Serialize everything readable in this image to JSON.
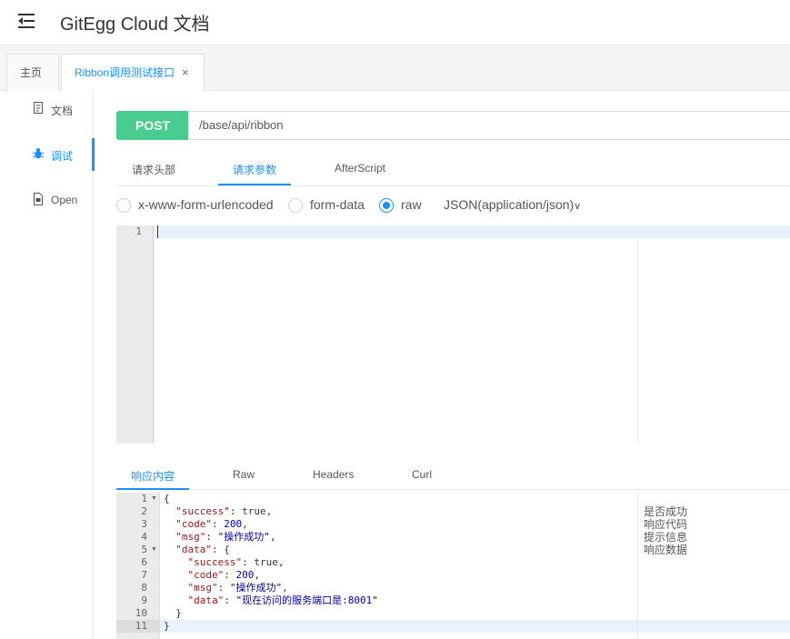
{
  "header": {
    "title": "GitEgg Cloud 文档",
    "menu_icon": "menu-fold-icon"
  },
  "page_tabs": [
    {
      "label": "主页",
      "active": false
    },
    {
      "label": "Ribbon调用测试接口",
      "active": true,
      "close_icon": "×"
    }
  ],
  "sidebar": {
    "items": [
      {
        "label": "文档",
        "icon": "document-icon",
        "active": false
      },
      {
        "label": "调试",
        "icon": "bug-icon",
        "active": true
      },
      {
        "label": "Open",
        "icon": "file-icon",
        "active": false
      }
    ]
  },
  "request": {
    "method": "POST",
    "method_color": "#49cc90",
    "url": "/base/api/ribbon",
    "tabs": [
      "请求头部",
      "请求参数",
      "AfterScript"
    ],
    "active_tab": "请求参数",
    "body_types": [
      "x-www-form-urlencoded",
      "form-data",
      "raw"
    ],
    "selected_body_type": "raw",
    "content_type": "JSON(application/json)",
    "content_type_arrow": "∨",
    "editor_line_numbers": [
      "1"
    ]
  },
  "response": {
    "tabs": [
      "响应内容",
      "Raw",
      "Headers",
      "Curl"
    ],
    "active_tab": "响应内容",
    "line_numbers": [
      "1",
      "2",
      "3",
      "4",
      "5",
      "6",
      "7",
      "8",
      "9",
      "10",
      "11"
    ],
    "lines": {
      "l1": "{",
      "l2k": "\"success\"",
      "l2v": "true",
      "l3k": "\"code\"",
      "l3v": "200",
      "l4k": "\"msg\"",
      "l4v": "\"操作成功\"",
      "l5k": "\"data\"",
      "l5v": "{",
      "l6k": "\"success\"",
      "l6v": "true",
      "l7k": "\"code\"",
      "l7v": "200",
      "l8k": "\"msg\"",
      "l8v": "\"操作成功\"",
      "l9k": "\"data\"",
      "l9v": "\"现在访问的服务端口是:8001\"",
      "l10": "}",
      "l11": "}"
    },
    "comments": [
      "是否成功",
      "响应代码",
      "提示信息",
      "响应数据"
    ]
  },
  "colors": {
    "accent": "#1890ff",
    "post": "#49cc90"
  }
}
